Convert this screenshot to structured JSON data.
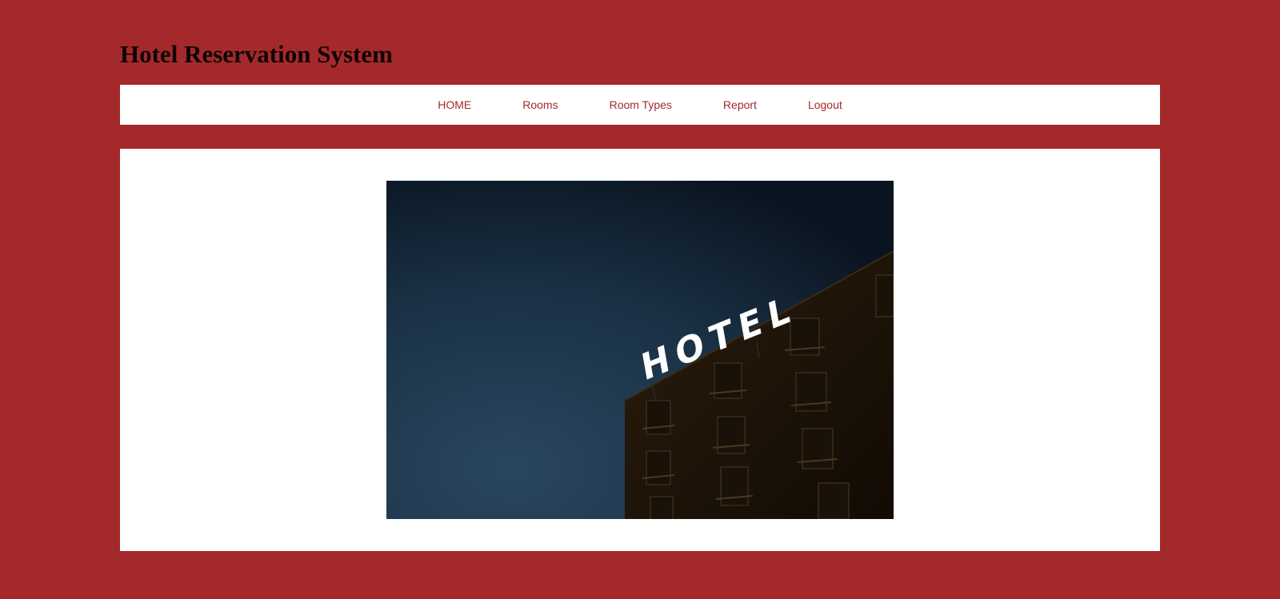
{
  "colors": {
    "background": "#a4292b",
    "panel": "#ffffff",
    "nav_text": "#a4292b",
    "title_text": "#0f0505"
  },
  "header": {
    "title": "Hotel Reservation System"
  },
  "nav": {
    "items": [
      {
        "label": "HOME"
      },
      {
        "label": "Rooms"
      },
      {
        "label": "Room Types"
      },
      {
        "label": "Report"
      },
      {
        "label": "Logout"
      }
    ]
  },
  "hero": {
    "sign_text": "HOTEL"
  }
}
